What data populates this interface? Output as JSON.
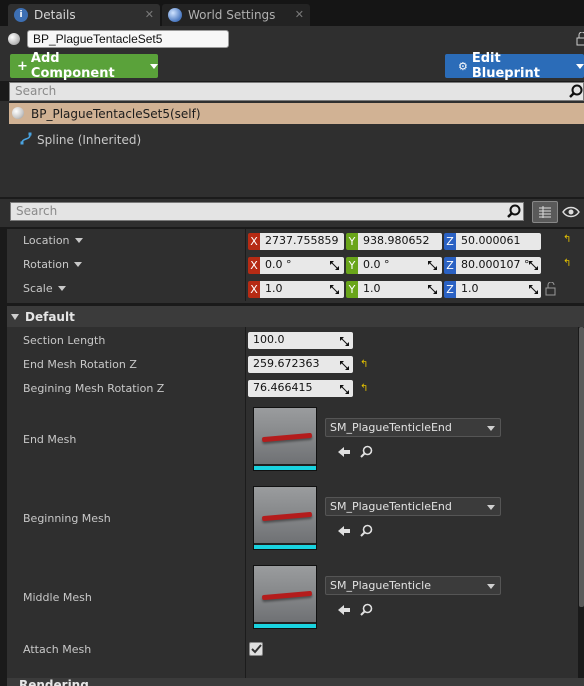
{
  "tabs": [
    {
      "label": "Details",
      "active": true
    },
    {
      "label": "World Settings",
      "active": false
    }
  ],
  "actor_name": "BP_PlagueTentacleSet5",
  "toolbar": {
    "add_component_label": "Add Component",
    "edit_blueprint_label": "Edit Blueprint",
    "add_color": "#5aa23a",
    "edit_color": "#2b6cb8"
  },
  "component_search": {
    "placeholder": "Search"
  },
  "components": [
    {
      "label": "BP_PlagueTentacleSet5(self)",
      "selected": true
    },
    {
      "label": "Spline (Inherited)",
      "selected": false
    }
  ],
  "details_search": {
    "placeholder": "Search"
  },
  "transform": {
    "location": {
      "label": "Location",
      "x": "2737.755859",
      "y": "938.980652",
      "z": "50.000061"
    },
    "rotation": {
      "label": "Rotation",
      "x": "0.0 °",
      "y": "0.0 °",
      "z": "80.000107 °"
    },
    "scale": {
      "label": "Scale",
      "x": "1.0",
      "y": "1.0",
      "z": "1.0"
    },
    "axis_labels": {
      "x": "X",
      "y": "Y",
      "z": "Z"
    }
  },
  "default_section": {
    "title": "Default",
    "section_length": {
      "label": "Section Length",
      "value": "100.0"
    },
    "end_mesh_rotation_z": {
      "label": "End Mesh Rotation Z",
      "value": "259.672363"
    },
    "begining_mesh_rotation_z": {
      "label": "Begining Mesh Rotation Z",
      "value": "76.466415"
    },
    "end_mesh": {
      "label": "End Mesh",
      "asset": "SM_PlagueTenticleEnd"
    },
    "beginning_mesh": {
      "label": "Beginning Mesh",
      "asset": "SM_PlagueTenticleEnd"
    },
    "middle_mesh": {
      "label": "Middle Mesh",
      "asset": "SM_PlagueTenticle"
    },
    "attach_mesh": {
      "label": "Attach Mesh",
      "checked": true
    }
  },
  "rendering_section": {
    "title": "Rendering"
  }
}
